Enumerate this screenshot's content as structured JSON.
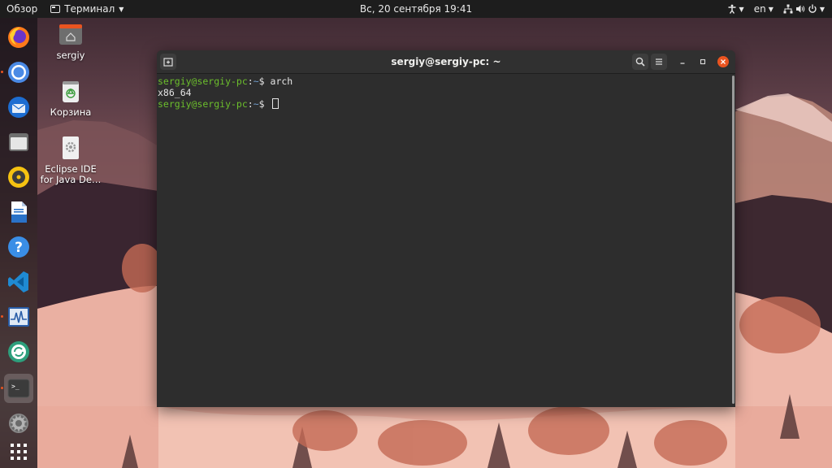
{
  "topbar": {
    "activities": "Обзор",
    "app_menu": "Терминал",
    "clock": "Вс, 20 сентября  19:41",
    "language": "en"
  },
  "dock": {
    "items": [
      {
        "name": "firefox-icon",
        "running": false
      },
      {
        "name": "chromium-icon",
        "running": true
      },
      {
        "name": "thunderbird-icon",
        "running": false
      },
      {
        "name": "files-icon",
        "running": false
      },
      {
        "name": "rhythmbox-icon",
        "running": false
      },
      {
        "name": "libreoffice-writer-icon",
        "running": false
      },
      {
        "name": "help-icon",
        "running": false
      },
      {
        "name": "vscode-icon",
        "running": false
      },
      {
        "name": "system-monitor-icon",
        "running": true
      },
      {
        "name": "software-updater-icon",
        "running": false
      },
      {
        "name": "terminal-icon",
        "running": true,
        "active": true
      },
      {
        "name": "settings-icon",
        "running": false
      },
      {
        "name": "show-apps-icon",
        "running": false
      }
    ]
  },
  "desktop": {
    "home_label": "sergiy",
    "trash_label": "Корзина",
    "eclipse_label_1": "Eclipse IDE",
    "eclipse_label_2": "for Java De…"
  },
  "terminal": {
    "title": "sergiy@sergiy-pc: ~",
    "lines": [
      {
        "user": "sergiy@sergiy-pc",
        "path": "~",
        "cmd": "arch"
      },
      {
        "output": "x86_64"
      },
      {
        "user": "sergiy@sergiy-pc",
        "path": "~",
        "cmd": ""
      }
    ]
  },
  "colors": {
    "accent": "#e95420",
    "prompt_user": "#6cbf2c",
    "prompt_path": "#729fcf",
    "terminal_bg": "#2d2d2d"
  }
}
